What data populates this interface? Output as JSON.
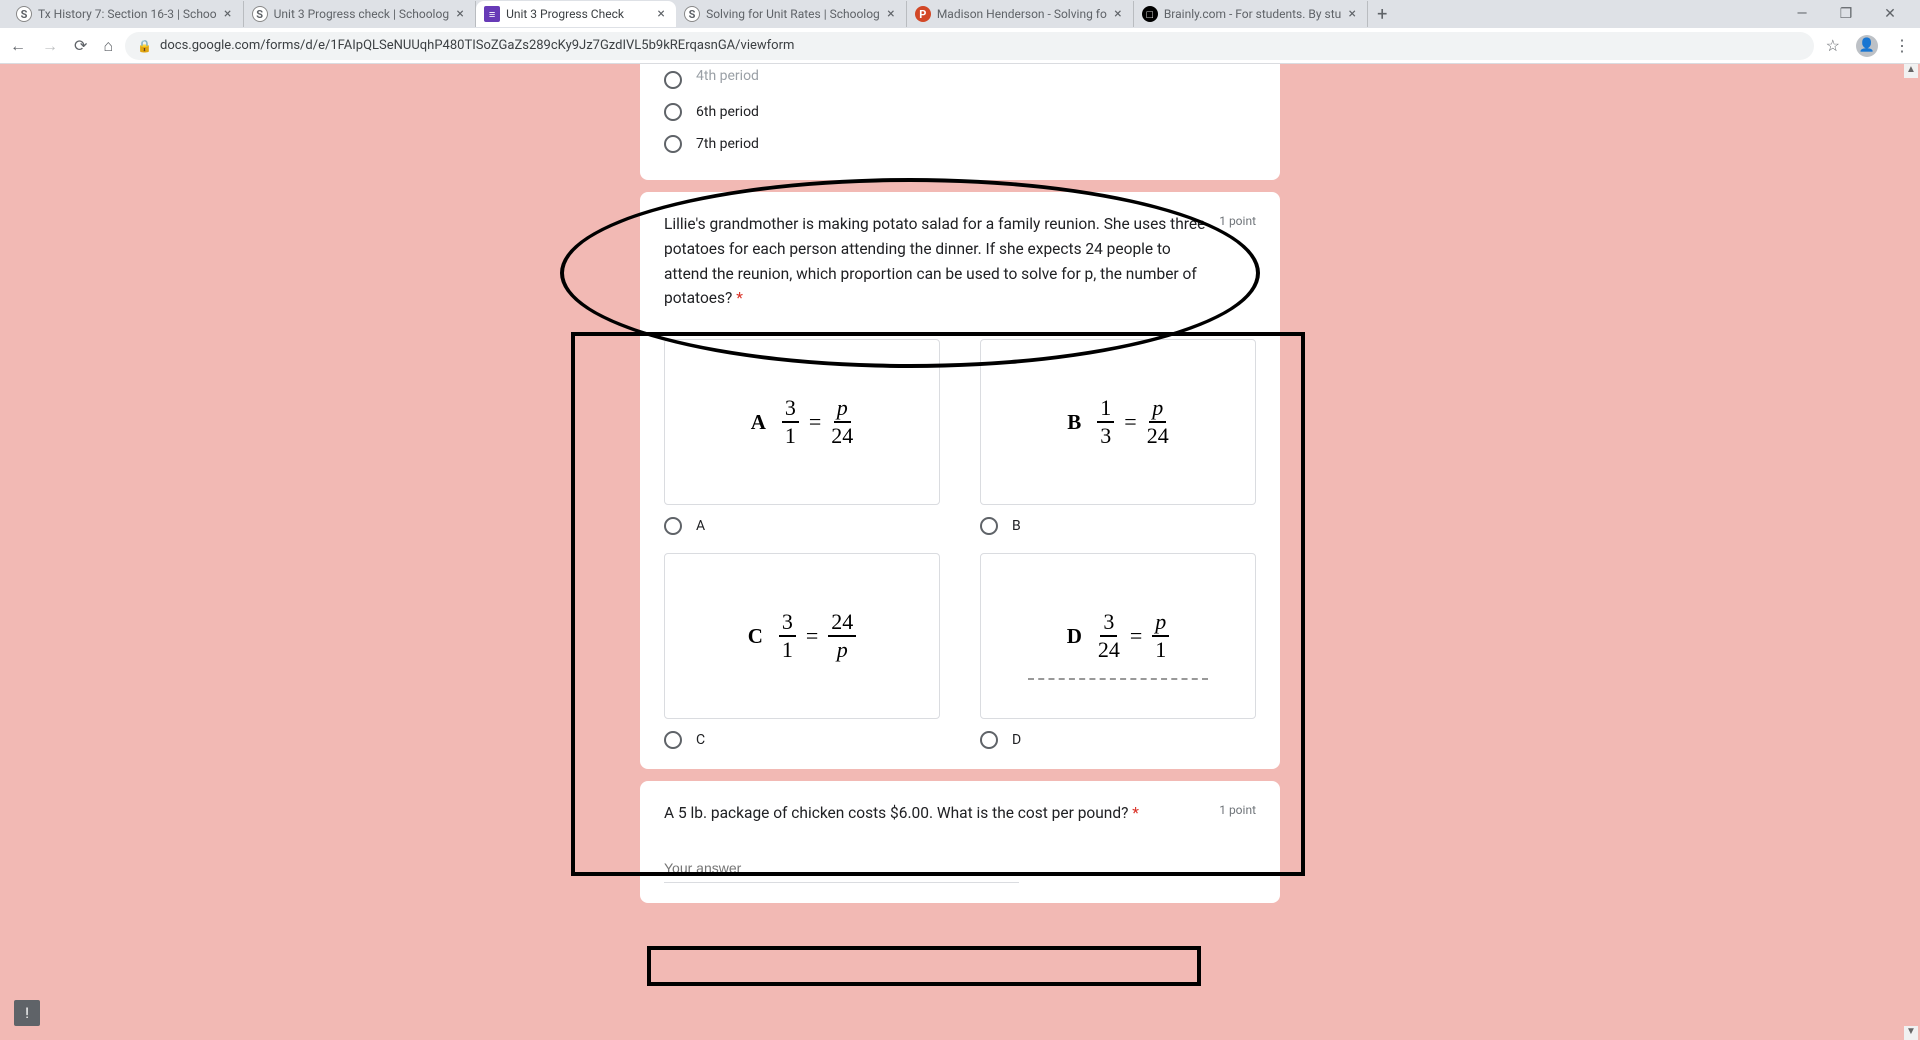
{
  "tabs": [
    {
      "title": "Tx History 7: Section 16-3 | Schoo"
    },
    {
      "title": "Unit 3 Progress check | Schoolog"
    },
    {
      "title": "Unit 3 Progress Check"
    },
    {
      "title": "Solving for Unit Rates | Schoolog"
    },
    {
      "title": "Madison Henderson - Solving fo"
    },
    {
      "title": "Brainly.com - For students. By stu"
    }
  ],
  "url": "docs.google.com/forms/d/e/1FAIpQLSeNUUqhP480TISoZGaZs289cKy9Jz7GzdIVL5b9kRErqasnGA/viewform",
  "periods": {
    "p4": "4th period",
    "p6": "6th period",
    "p7": "7th period"
  },
  "q1": {
    "text": "Lillie's grandmother is making potato salad for a family reunion. She uses three potatoes for each person attending the dinner. If she expects 24 people to attend the reunion, which proportion can be used to solve for p, the number of potatoes?",
    "asterisk": "*",
    "points": "1 point",
    "choices": {
      "A": {
        "letter": "A",
        "lhs_num": "3",
        "lhs_den": "1",
        "rhs_num": "p",
        "rhs_den": "24",
        "label": "A"
      },
      "B": {
        "letter": "B",
        "lhs_num": "1",
        "lhs_den": "3",
        "rhs_num": "p",
        "rhs_den": "24",
        "label": "B"
      },
      "C": {
        "letter": "C",
        "lhs_num": "3",
        "lhs_den": "1",
        "rhs_num": "24",
        "rhs_den": "p",
        "label": "C"
      },
      "D": {
        "letter": "D",
        "lhs_num": "3",
        "lhs_den": "24",
        "rhs_num": "p",
        "rhs_den": "1",
        "label": "D"
      }
    }
  },
  "q2": {
    "text": "A 5 lb. package of chicken costs $6.00. What is the cost per pound?",
    "asterisk": "*",
    "points": "1 point",
    "placeholder": "Your answer"
  }
}
